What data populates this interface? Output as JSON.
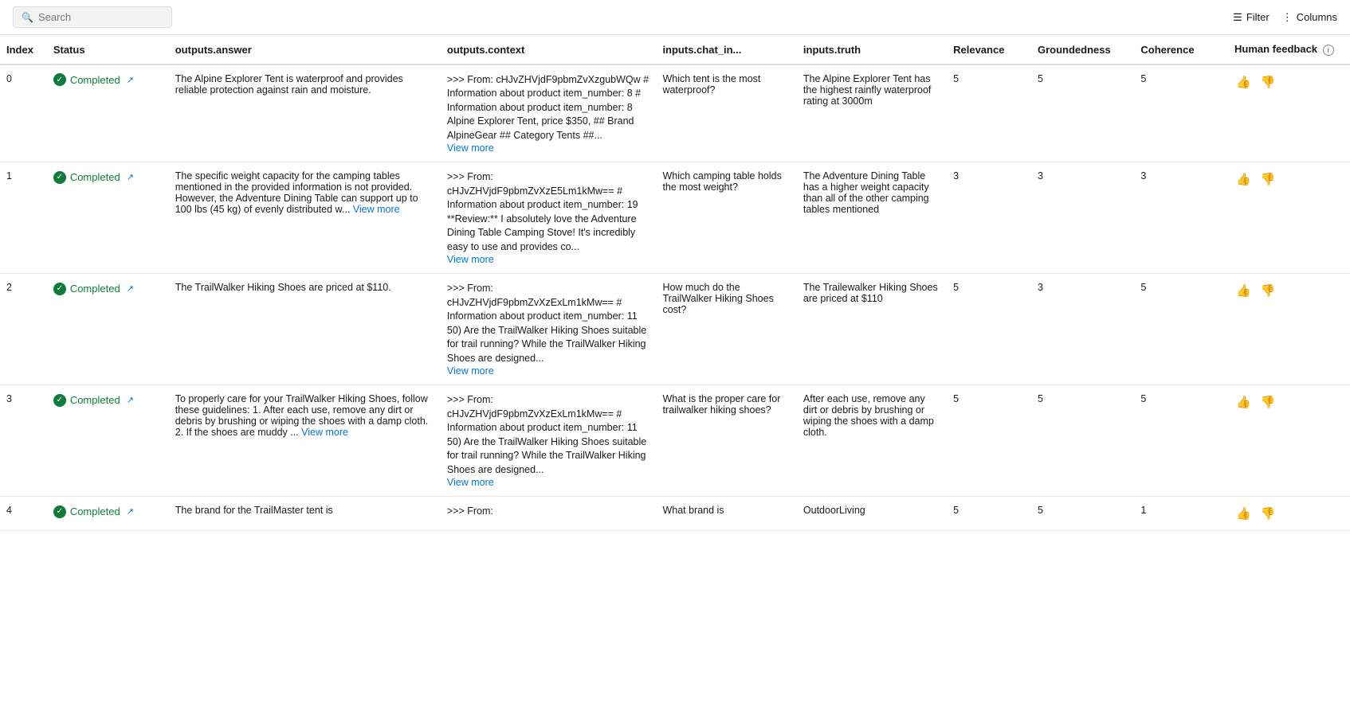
{
  "search": {
    "placeholder": "Search"
  },
  "toolbar": {
    "filter_label": "Filter",
    "columns_label": "Columns"
  },
  "table": {
    "headers": {
      "index": "Index",
      "status": "Status",
      "outputs_answer": "outputs.answer",
      "outputs_context": "outputs.context",
      "inputs_chat_in": "inputs.chat_in...",
      "inputs_truth": "inputs.truth",
      "relevance": "Relevance",
      "groundedness": "Groundedness",
      "coherence": "Coherence",
      "human_feedback": "Human feedback"
    },
    "rows": [
      {
        "index": "0",
        "status": "Completed",
        "answer": "The Alpine Explorer Tent is waterproof and provides reliable protection against rain and moisture.",
        "context_prefix": ">>> From: cHJvZHVjdF9pbmZvXzgubWQw # Information about product item_number: 8 # Information about product item_number: 8 Alpine Explorer Tent, price $350, ## Brand AlpineGear ## Category Tents ##...",
        "context_has_more": true,
        "chat_in": "Which tent is the most waterproof?",
        "truth": "The Alpine Explorer Tent has the highest rainfly waterproof rating at 3000m",
        "relevance": "5",
        "groundedness": "5",
        "coherence": "5"
      },
      {
        "index": "1",
        "status": "Completed",
        "answer": "The specific weight capacity for the camping tables mentioned in the provided information is not provided. However, the Adventure Dining Table can support up to 100 lbs (45 kg) of evenly distributed w...",
        "answer_has_more": true,
        "context_prefix": ">>> From: cHJvZHVjdF9pbmZvXzE5Lm1kMw== # Information about product item_number: 19 **Review:** I absolutely love the Adventure Dining Table Camping Stove! It's incredibly easy to use and provides co...",
        "context_has_more": true,
        "chat_in": "Which camping table holds the most weight?",
        "truth": "The Adventure Dining Table has a higher weight capacity than all of the other camping tables mentioned",
        "relevance": "3",
        "groundedness": "3",
        "coherence": "3"
      },
      {
        "index": "2",
        "status": "Completed",
        "answer": "The TrailWalker Hiking Shoes are priced at $110.",
        "context_prefix": ">>> From: cHJvZHVjdF9pbmZvXzExLm1kMw== # Information about product item_number: 11 50) Are the TrailWalker Hiking Shoes suitable for trail running? While the TrailWalker Hiking Shoes are designed...",
        "context_has_more": true,
        "chat_in": "How much do the TrailWalker Hiking Shoes cost?",
        "truth": "The Trailewalker Hiking Shoes are priced at $110",
        "relevance": "5",
        "groundedness": "3",
        "coherence": "5"
      },
      {
        "index": "3",
        "status": "Completed",
        "answer": "To properly care for your TrailWalker Hiking Shoes, follow these guidelines: 1. After each use, remove any dirt or debris by brushing or wiping the shoes with a damp cloth. 2. If the shoes are muddy ...",
        "answer_has_more": true,
        "context_prefix": ">>> From: cHJvZHVjdF9pbmZvXzExLm1kMw== # Information about product item_number: 11 50) Are the TrailWalker Hiking Shoes suitable for trail running? While the TrailWalker Hiking Shoes are designed...",
        "context_has_more": true,
        "chat_in": "What is the proper care for trailwalker hiking shoes?",
        "truth": "After each use, remove any dirt or debris by brushing or wiping the shoes with a damp cloth.",
        "relevance": "5",
        "groundedness": "5",
        "coherence": "5"
      },
      {
        "index": "4",
        "status": "Completed",
        "answer": "The brand for the TrailMaster tent is",
        "context_prefix": ">>> From:",
        "context_has_more": false,
        "chat_in": "What brand is",
        "truth": "OutdoorLiving",
        "relevance": "5",
        "groundedness": "5",
        "coherence": "1"
      }
    ]
  }
}
